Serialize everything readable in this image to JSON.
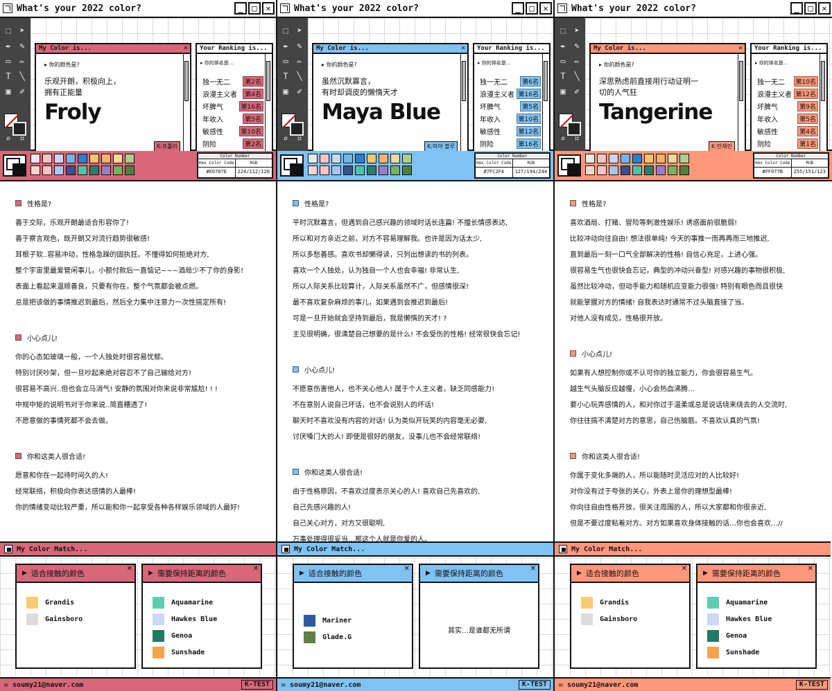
{
  "app_title": "What's your 2022 color?",
  "labels": {
    "color_window": "My Color is...",
    "ranking_window": "Your Ranking is...",
    "color_question": "你的颜色是?",
    "ranking_question": "你的排名是…",
    "color_number": "Color Number",
    "hex_label": "Hex Color Code",
    "rgb_label": "RGB",
    "match_title": "My Color Match...",
    "good_title": "适合接触的颜色",
    "bad_title": "需要保持距离的颜色",
    "footer_email": "soumy21@naver.com",
    "footer_tag": "K-TEST",
    "sec1": "性格是?",
    "sec2": "小心点儿!",
    "sec3": "你和这类人很合适!"
  },
  "rank_labels": [
    "独一无二",
    "浪漫主义者",
    "坏脾气",
    "年收入",
    "敏感性",
    "阴险"
  ],
  "palette": [
    "#e8e8e8",
    "#f2c6c6",
    "#c9d8f0",
    "#72b6e6",
    "#2d7fc9",
    "#f7c46e",
    "#f1b26c",
    "#f2d89a",
    "#a8d08d",
    "#f9d4d4",
    "#f9c3c8",
    "#a9c6ef",
    "#3c4f8e",
    "#4fc4a8",
    "#2f7d67",
    "#9d7ec2",
    "#7eaf5e",
    "#4e7f3e"
  ],
  "panels": [
    {
      "theme": "#d9677a",
      "tab_bg": "#e8858f",
      "rank_bg": "#e8858f",
      "desc1": "乐观开朗，积极向上，",
      "desc2": "拥有正能量",
      "name": "Froly",
      "k_name": "K:프롤리",
      "ranks": [
        "第2名",
        "第4名",
        "第16名",
        "第5名",
        "第10名",
        "第2名"
      ],
      "hex": "#E0707E",
      "rgb": "224/112/126",
      "sec1_lines": [
        "善于交际，乐观开朗最适合形容你了!",
        "善于察言观色，既开朗又对流行趋势很敏感!",
        "耳根子软..容易冲动，性格急躁的固执狂。不懂得如何拒绝对方,",
        "整个宇宙里最爱管闲事儿，小额付款后一直惦记~~~酒局少不了你的身影!",
        "表面上看起来温顺善良，只要有你在，整个气氛都会被点燃。",
        "总是把该做的事情推迟到最后，然后全力集中注意力一次性搞定所有!"
      ],
      "sec2_lines": [
        "你的心态如玻璃一般，一个人独处时很容易忧郁。",
        "特别讨厌吵架，但一旦吵起来绝对容忍不了自己输给对方!",
        "很容易不高兴..但也会立马消气! 安静的氛围对你来说非常尴尬! ! !",
        "中规中矩的说明书对于你来说..简直糟透了!",
        "不愿意做的事情死都不会去做。"
      ],
      "sec3_lines": [
        "愿意和你在一起待时间久的人!",
        "经常联络，积极向你表达感情的人最棒!",
        "你的情绪变动比较严重，所以能和你一起享受各种各样娱乐领域的人最好!"
      ],
      "good": [
        {
          "name": "Grandis",
          "color": "#f9cc74"
        },
        {
          "name": "Gainsboro",
          "color": "#dcdcdc"
        }
      ],
      "bad": [
        {
          "name": "Aquamarine",
          "color": "#5ccfb2"
        },
        {
          "name": "Hawkes Blue",
          "color": "#cbd8f6"
        },
        {
          "name": "Genoa",
          "color": "#217a63"
        },
        {
          "name": "Sunshade",
          "color": "#f7a34b"
        }
      ],
      "bad_none": ""
    },
    {
      "theme": "#7fc2f4",
      "tab_bg": "#7fc2f4",
      "rank_bg": "#7fc2f4",
      "desc1": "虽然沉默寡言，",
      "desc2": "有时却调皮的懒惰天才",
      "name": "Maya Blue",
      "k_name": "K:마야 블루",
      "ranks": [
        "第6名",
        "第16名",
        "第5名",
        "第10名",
        "第12名",
        "第16名"
      ],
      "hex": "#7FC2F4",
      "rgb": "127/194/244",
      "sec1_lines": [
        "平时沉默寡言，但遇到自己感兴趣的领域时话长连篇! 不擅长情感表达,",
        "所以和对方亲近之前，对方不容易理解我。也许是因为话太少,",
        "所以多愁善感。喜欢书却懒得读，只列出想读的书的列表。",
        "喜欢一个人独处，认为独自一个人也会幸福! 非常认生,",
        "所以人际关系比较算计，人际关系虽然不广，但感情很深!",
        "最不喜欢复杂麻烦的事儿，如果遇到会推迟到最后!",
        "可是一旦开始就会坚持到最后，我是懒惰的天才! ?",
        "主见很明确，很清楚自己想要的是什么! 不会受伤的性格! 经常很快会忘记!"
      ],
      "sec2_lines": [
        "不愿意伤害他人，也不关心他人! 属于个人主义者，缺乏同感能力!",
        "不在意别人说自己坏话，也不会说别人的坏话!",
        "聊天时不喜欢没有内容的对话! 认为类似开玩笑的内容毫无必要,",
        "讨厌嗓门大的人! 即使是很好的朋友，没事儿也不会经常联络!"
      ],
      "sec3_lines": [
        "由于性格原因，不喜欢过度表示关心的人! 喜欢自己先喜欢的,",
        "自己先感兴趣的人!",
        "自己关心对方，对方又很聪明,",
        "万事处理得很妥当…那这个人就是你爱的人。"
      ],
      "good": [
        {
          "name": "Mariner",
          "color": "#2d5aa0"
        },
        {
          "name": "Glade.G",
          "color": "#5e7f46"
        }
      ],
      "bad": [],
      "bad_none": "其实…是谁都无所谓"
    },
    {
      "theme": "#ff977b",
      "tab_bg": "#ff977b",
      "rank_bg": "#ff977b",
      "desc1": "深思熟虑前直接用行动证明一",
      "desc2": "切的人气狂",
      "name": "Tangerine",
      "k_name": "K:탄제린",
      "ranks": [
        "第10名",
        "第12名",
        "第9名",
        "第5名",
        "第4名",
        "第1名"
      ],
      "hex": "#FF977B",
      "rgb": "255/151/123",
      "sec1_lines": [
        "喜欢酒局、打赌、冒险等刺激性娱乐! 诱惑面前很脆弱!",
        "比较冲动向往自由! 想法很单纯! 今天的事推一而再再而三地推迟,",
        "直到最后一刻一口气全部解决的性格! 自信心充足，上进心强。",
        "很容易生气也很快会忘记，典型的冲动兴奋型! 对感兴趣的事物很积极,",
        "虽然比较冲动，但动手能力和随机应变能力很强! 特别有眼色而且很快",
        "就能掌握对方的情绪! 自我表达时通常不过头脑直接了当。",
        "对他人没有成见，性格很开放。"
      ],
      "sec2_lines": [
        "如果有人想控制你或不认可你的独立能力，你会很容易生气。",
        "越生气头脑反应越慢，小心会热血沸腾…",
        "要小心玩弄感情的人，和对你过于温柔或总是说话绕来绕去的人交流时,",
        "你往往搞不清楚对方的意思，自己伤脑筋。不喜欢认真的气氛!"
      ],
      "sec3_lines": [
        "你属于变化多端的人，所以能随时灵活应对的人比较好!",
        "对你没有过于夸张的关心，外表上是你的理想型最棒!",
        "你向往自由性格开放，很关注周围的人，所以大家都和你很亲近,",
        "但是不要过度粘着对方。对方如果喜欢身体接触的话…你也会喜欢…//"
      ],
      "good": [
        {
          "name": "Grandis",
          "color": "#f9cc74"
        },
        {
          "name": "Gainsboro",
          "color": "#dcdcdc"
        }
      ],
      "bad": [
        {
          "name": "Aquamarine",
          "color": "#5ccfb2"
        },
        {
          "name": "Hawkes Blue",
          "color": "#cbd8f6"
        },
        {
          "name": "Genoa",
          "color": "#217a63"
        },
        {
          "name": "Sunshade",
          "color": "#f7a34b"
        }
      ],
      "bad_none": ""
    }
  ]
}
